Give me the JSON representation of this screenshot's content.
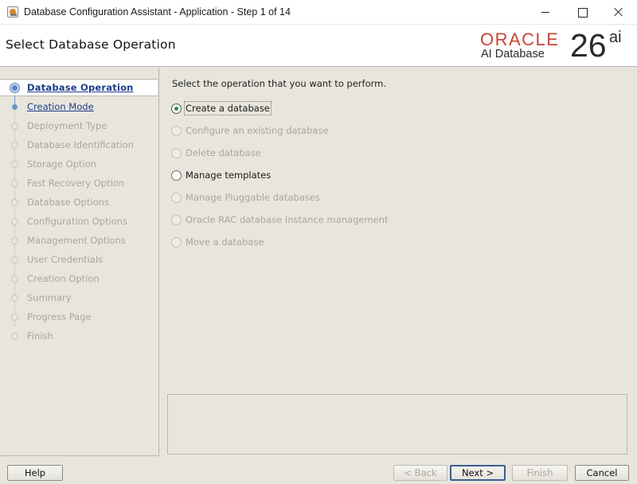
{
  "window": {
    "title": "Database Configuration Assistant - Application - Step 1 of 14",
    "app_icon": "dbca-app-icon",
    "controls": [
      "minimize-icon",
      "maximize-icon",
      "close-icon"
    ]
  },
  "header": {
    "page_title": "Select Database Operation",
    "brand_word": "ORACLE",
    "brand_product": "AI Database",
    "brand_version": "26",
    "brand_version_suffix": "ai",
    "brand_color": "#c74634"
  },
  "steps": {
    "items": [
      {
        "label": "Database Operation",
        "state": "current"
      },
      {
        "label": "Creation Mode",
        "state": "next"
      },
      {
        "label": "Deployment Type",
        "state": "pending"
      },
      {
        "label": "Database Identification",
        "state": "pending"
      },
      {
        "label": "Storage Option",
        "state": "pending"
      },
      {
        "label": "Fast Recovery Option",
        "state": "pending"
      },
      {
        "label": "Database Options",
        "state": "pending"
      },
      {
        "label": "Configuration Options",
        "state": "pending"
      },
      {
        "label": "Management Options",
        "state": "pending"
      },
      {
        "label": "User Credentials",
        "state": "pending"
      },
      {
        "label": "Creation Option",
        "state": "pending"
      },
      {
        "label": "Summary",
        "state": "pending"
      },
      {
        "label": "Progress Page",
        "state": "pending"
      },
      {
        "label": "Finish",
        "state": "pending"
      }
    ]
  },
  "main": {
    "instruction": "Select the operation that you want to perform.",
    "options": [
      {
        "label": "Create a database",
        "selected": true,
        "enabled": true
      },
      {
        "label": "Configure an existing database",
        "selected": false,
        "enabled": false
      },
      {
        "label": "Delete database",
        "selected": false,
        "enabled": false
      },
      {
        "label": "Manage templates",
        "selected": false,
        "enabled": true
      },
      {
        "label": "Manage Pluggable databases",
        "selected": false,
        "enabled": false
      },
      {
        "label": "Oracle RAC database Instance management",
        "selected": false,
        "enabled": false
      },
      {
        "label": "Move a database",
        "selected": false,
        "enabled": false
      }
    ],
    "selected_color": "#2f8a46"
  },
  "footer": {
    "help_label": "Help",
    "back_label": "< Back",
    "next_label": "Next >",
    "finish_label": "Finish",
    "cancel_label": "Cancel"
  }
}
